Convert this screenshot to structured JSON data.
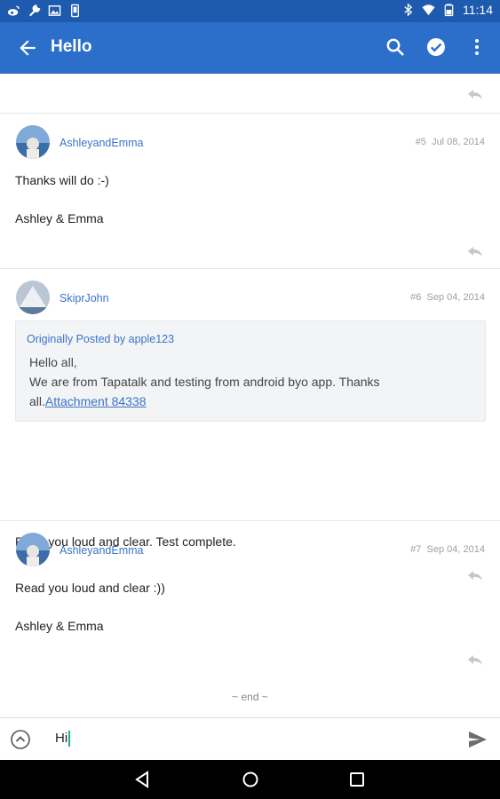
{
  "status_bar": {
    "time": "11:14",
    "left_icons": [
      "weibo-icon",
      "wrench-icon",
      "picture-icon",
      "phone-icon"
    ],
    "right_icons": [
      "bluetooth-icon",
      "wifi-icon",
      "battery-icon"
    ]
  },
  "app_bar": {
    "title": "Hello",
    "back_icon": "arrow-back-icon",
    "actions": [
      "search-icon",
      "check-circle-icon",
      "more-vert-icon"
    ]
  },
  "posts": [
    {
      "username": "AshleyandEmma",
      "number": "#5",
      "date": "Jul 08, 2014",
      "lines": [
        "Thanks will do :-)",
        "Ashley & Emma"
      ]
    },
    {
      "username": "SkiprJohn",
      "number": "#6",
      "date": "Sep 04, 2014",
      "quote": {
        "header": "Originally Posted by apple123",
        "line1": "Hello all,",
        "line2": "We are from Tapatalk and testing from android byo app. Thanks",
        "line3_prefix": "all.",
        "link": "Attachment 84338"
      },
      "lines": [
        "Read you loud and clear. Test complete."
      ]
    },
    {
      "username": "AshleyandEmma",
      "number": "#7",
      "date": "Sep 04, 2014",
      "lines": [
        "Read you loud and clear :))",
        "Ashley & Emma"
      ]
    }
  ],
  "end_label": "~ end ~",
  "composer": {
    "value": "Hi",
    "expand_icon": "chevron-up-circle-icon",
    "send_icon": "send-icon"
  },
  "nav_bar": [
    "back-triangle-icon",
    "home-circle-icon",
    "recents-square-icon"
  ],
  "colors": {
    "status_bar": "#1e5aad",
    "app_bar": "#2b6fcb",
    "link": "#3a74c8",
    "meta": "#9aa0a6"
  }
}
